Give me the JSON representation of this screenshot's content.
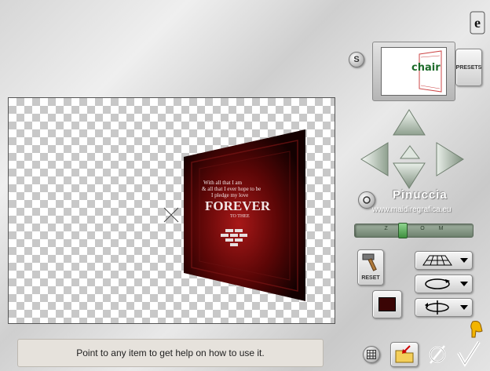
{
  "status_bar": {
    "text": "Point to any item to get help on how to use it."
  },
  "presets": {
    "label": "PRESETS"
  },
  "shuffle": {
    "label": "S"
  },
  "reset": {
    "label": "RESET"
  },
  "preview": {
    "thumbnail_text": "chair"
  },
  "zoom": {
    "label": "ZOOM",
    "position": 0.4
  },
  "watermark": {
    "name": "Pinuccia",
    "url": "www.maidiregrafica.eu"
  },
  "artwork": {
    "line1": "With all that I am",
    "line2": "& all that I ever hope to be",
    "line3": "I pledge my love",
    "title": "FOREVER",
    "subtitle": "TO THEE"
  },
  "colors": {
    "artwork_dark": "#1a0202",
    "artwork_mid": "#7a0d0d",
    "selected_color": "#3a0505",
    "accent_gold": "#f0b400"
  },
  "icons": {
    "help": "help-icon",
    "move_up": "arrow-up-icon",
    "move_down": "arrow-down-icon",
    "move_left": "arrow-left-icon",
    "move_right": "arrow-right-icon",
    "center": "center-icon",
    "grid": "grid-icon",
    "folder": "folder-icon",
    "cancel": "cancel-icon",
    "ok": "checkmark-icon",
    "hand": "pointing-hand-icon"
  }
}
